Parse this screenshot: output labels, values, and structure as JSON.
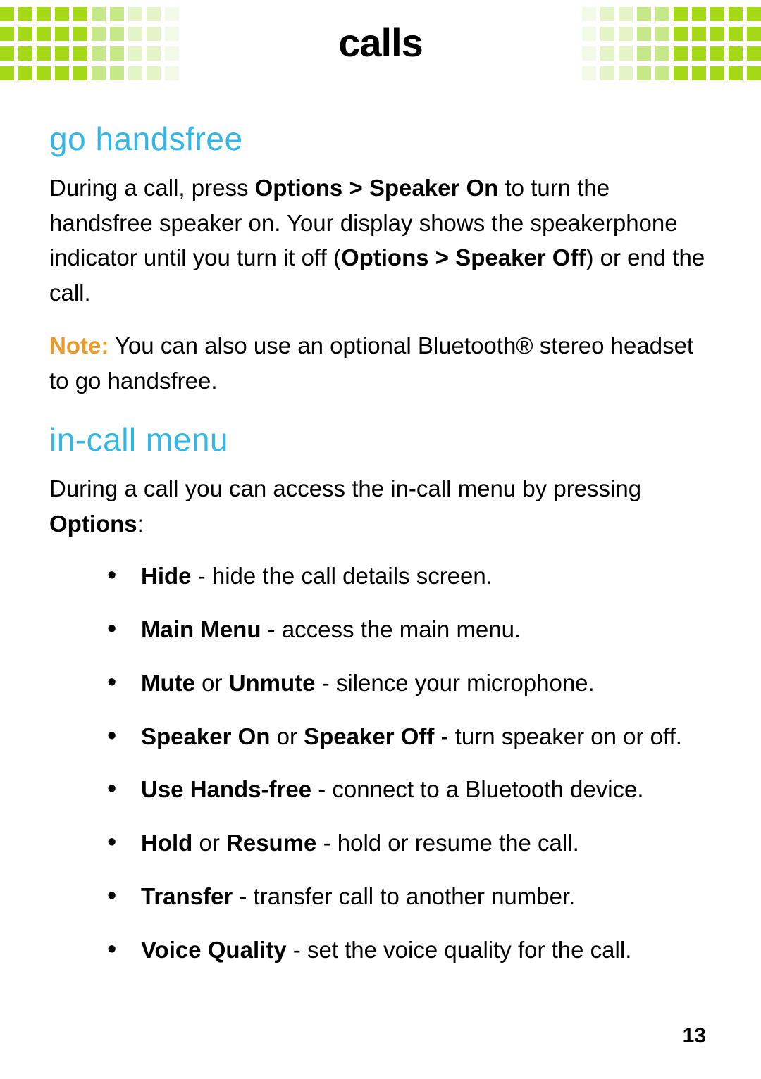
{
  "header": {
    "title": "calls"
  },
  "sections": {
    "handsfree": {
      "heading": "go handsfree",
      "p1_a": "During a call, press ",
      "p1_b1": "Options > Speaker On",
      "p1_c": " to turn the handsfree speaker on. Your display shows the speakerphone indicator until you turn it off (",
      "p1_b2": "Options > Speaker Off",
      "p1_d": ") or end the call.",
      "note_label": "Note:",
      "note_text": " You can also use an optional Bluetooth® stereo headset to go handsfree."
    },
    "incall": {
      "heading": "in-call menu",
      "intro_a": "During a call you can access the in-call menu by pressing ",
      "intro_b": "Options",
      "intro_c": ":",
      "items": [
        {
          "b1": "Hide",
          "t1": " - hide the call details screen."
        },
        {
          "b1": "Main Menu",
          "t1": " - access the main menu."
        },
        {
          "b1": "Mute",
          "t1": " or ",
          "b2": "Unmute",
          "t2": " - silence your microphone."
        },
        {
          "b1": "Speaker On",
          "t1": " or ",
          "b2": "Speaker Off",
          "t2": " - turn speaker on or off."
        },
        {
          "b1": "Use Hands-free",
          "t1": " - connect to a Bluetooth device."
        },
        {
          "b1": "Hold",
          "t1": " or ",
          "b2": "Resume",
          "t2": " - hold or resume the call."
        },
        {
          "b1": "Transfer",
          "t1": " - transfer call to another number."
        },
        {
          "b1": "Voice Quality",
          "t1": " - set the voice quality for the call."
        }
      ]
    }
  },
  "page_number": "13",
  "colors": {
    "green_strong": "#a5d817",
    "green_mid": "#c7e889",
    "green_light": "#e5f4c6"
  }
}
